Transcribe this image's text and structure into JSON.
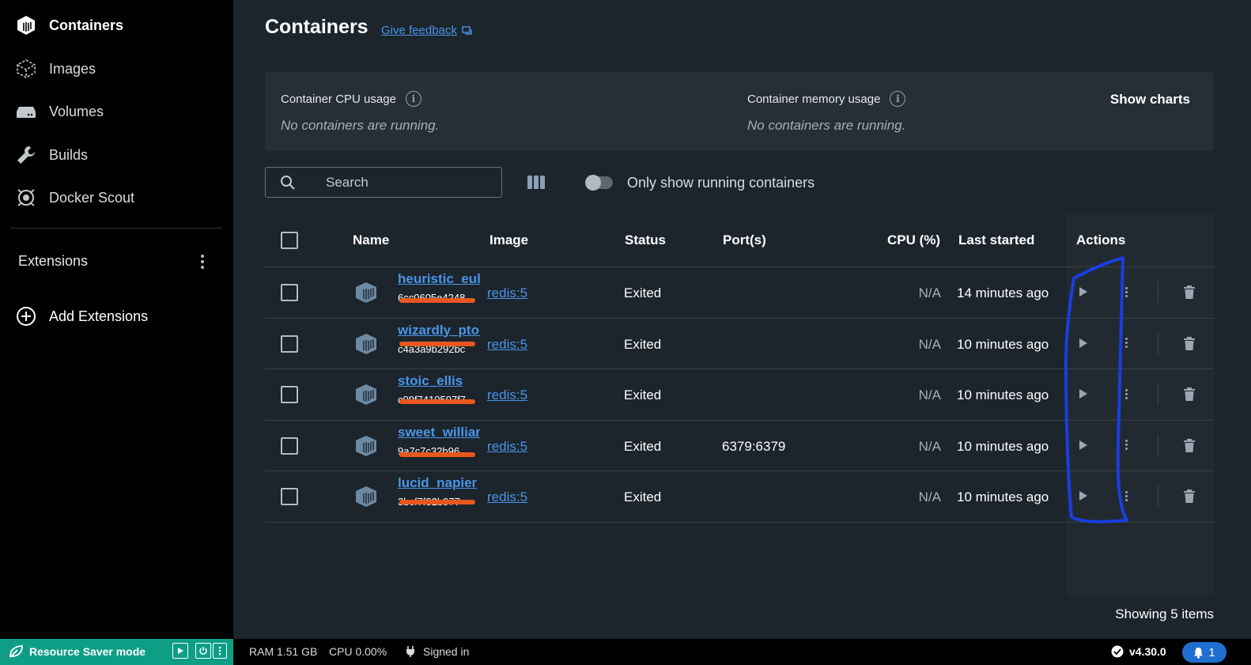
{
  "sidebar": {
    "items": [
      {
        "label": "Containers",
        "icon": "containers-icon",
        "active": true
      },
      {
        "label": "Images",
        "icon": "images-icon"
      },
      {
        "label": "Volumes",
        "icon": "volumes-icon"
      },
      {
        "label": "Builds",
        "icon": "wrench-icon"
      },
      {
        "label": "Docker Scout",
        "icon": "scout-icon"
      }
    ],
    "extensions_title": "Extensions",
    "add_extensions_label": "Add Extensions"
  },
  "header": {
    "title": "Containers",
    "feedback_label": "Give feedback"
  },
  "usage": {
    "cpu_label": "Container CPU usage",
    "cpu_empty": "No containers are running.",
    "memory_label": "Container memory usage",
    "memory_empty": "No containers are running.",
    "show_charts_label": "Show charts"
  },
  "toolbar": {
    "search_placeholder": "Search",
    "toggle_label": "Only show running containers",
    "toggle_on": false
  },
  "table": {
    "columns": [
      "Name",
      "Image",
      "Status",
      "Port(s)",
      "CPU (%)",
      "Last started",
      "Actions"
    ],
    "rows": [
      {
        "name": "heuristic_euler",
        "id": "6cc0605e4248",
        "image": "redis:5",
        "status": "Exited",
        "ports": "",
        "cpu": "N/A",
        "last_started": "14 minutes ago"
      },
      {
        "name": "wizardly_ptolemy",
        "id": "c4a3a9b292bc",
        "image": "redis:5",
        "status": "Exited",
        "ports": "",
        "cpu": "N/A",
        "last_started": "10 minutes ago"
      },
      {
        "name": "stoic_ellis",
        "id": "c09f7410597f7",
        "image": "redis:5",
        "status": "Exited",
        "ports": "",
        "cpu": "N/A",
        "last_started": "10 minutes ago"
      },
      {
        "name": "sweet_williams",
        "id": "9a7c7c32b96",
        "image": "redis:5",
        "status": "Exited",
        "ports": "6379:6379",
        "cpu": "N/A",
        "last_started": "10 minutes ago"
      },
      {
        "name": "lucid_napier",
        "id": "3bcf7f32b977",
        "image": "redis:5",
        "status": "Exited",
        "ports": "",
        "cpu": "N/A",
        "last_started": "10 minutes ago"
      }
    ],
    "showing_label": "Showing 5 items"
  },
  "footer": {
    "resource_saver_label": "Resource Saver mode",
    "ram": "RAM 1.51 GB",
    "cpu": "CPU 0.00%",
    "signed_in": "Signed in",
    "version": "v4.30.0",
    "notifications": "1"
  },
  "colors": {
    "accent": "#4a95e8",
    "resource_saver": "#0e9e86",
    "annotation": "#1a3ee0",
    "redaction": "#e8581e"
  }
}
